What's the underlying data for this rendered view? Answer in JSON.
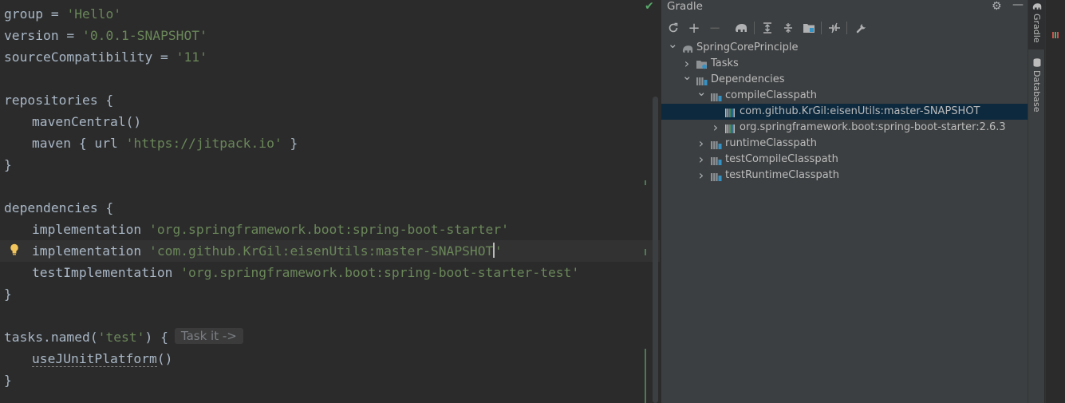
{
  "editor": {
    "lines": [
      {
        "parts": [
          {
            "t": "group",
            "c": "kw"
          },
          {
            "t": " = ",
            "c": "kw"
          },
          {
            "t": "'Hello'",
            "c": "str"
          }
        ]
      },
      {
        "parts": [
          {
            "t": "version",
            "c": "kw"
          },
          {
            "t": " = ",
            "c": "kw"
          },
          {
            "t": "'0.0.1-SNAPSHOT'",
            "c": "str"
          }
        ]
      },
      {
        "parts": [
          {
            "t": "sourceCompatibility",
            "c": "kw"
          },
          {
            "t": " = ",
            "c": "kw"
          },
          {
            "t": "'11'",
            "c": "str"
          }
        ]
      },
      {
        "parts": []
      },
      {
        "parts": [
          {
            "t": "repositories {",
            "c": "kw"
          }
        ]
      },
      {
        "parts": [
          {
            "t": "mavenCentral()",
            "c": "meth"
          }
        ],
        "indent": true
      },
      {
        "parts": [
          {
            "t": "maven { url ",
            "c": "meth"
          },
          {
            "t": "'https://jitpack.io'",
            "c": "str"
          },
          {
            "t": " }",
            "c": "kw"
          }
        ],
        "indent": true
      },
      {
        "parts": [
          {
            "t": "}",
            "c": "kw"
          }
        ]
      },
      {
        "parts": []
      },
      {
        "parts": [
          {
            "t": "dependencies {",
            "c": "kw"
          }
        ]
      },
      {
        "parts": [
          {
            "t": "implementation ",
            "c": "meth"
          },
          {
            "t": "'org.springframework.boot:spring-boot-starter'",
            "c": "str"
          }
        ],
        "indent": true
      },
      {
        "parts": [
          {
            "t": "implementation ",
            "c": "meth"
          },
          {
            "t": "'com.github.KrGil:eisenUtils:master-SNAPSHOT",
            "c": "str"
          },
          {
            "caret": true
          },
          {
            "t": "'",
            "c": "str"
          }
        ],
        "indent": true,
        "current": true
      },
      {
        "parts": [
          {
            "t": "testImplementation ",
            "c": "meth"
          },
          {
            "t": "'org.springframework.boot:spring-boot-starter-test'",
            "c": "str"
          }
        ],
        "indent": true
      },
      {
        "parts": [
          {
            "t": "}",
            "c": "kw"
          }
        ]
      },
      {
        "parts": []
      },
      {
        "parts": [
          {
            "t": "tasks",
            "c": "kw"
          },
          {
            "t": ".named(",
            "c": "kw"
          },
          {
            "t": "'test'",
            "c": "str"
          },
          {
            "t": ") {",
            "c": "kw"
          },
          {
            "hint": "Task it ->"
          }
        ]
      },
      {
        "parts": [
          {
            "t": "useJUnitPlatform",
            "c": "meth",
            "u": true
          },
          {
            "t": "()",
            "c": "kw"
          }
        ],
        "indent": true
      },
      {
        "parts": [
          {
            "t": "}",
            "c": "kw"
          }
        ]
      }
    ]
  },
  "gradle": {
    "title": "Gradle",
    "header_buttons": [
      "gear-icon",
      "minimize-icon"
    ],
    "toolbar": [
      "refresh-icon",
      "add-icon",
      "remove-icon",
      "elephant-icon",
      "expand-all-icon",
      "collapse-all-icon",
      "folder-icon",
      "toggle-offline-icon",
      "wrench-icon"
    ],
    "tree": [
      {
        "label": "SpringCorePrinciple",
        "level": 0,
        "arrow": "down",
        "icon": "elephant"
      },
      {
        "label": "Tasks",
        "level": 1,
        "arrow": "right",
        "icon": "folder-gear"
      },
      {
        "label": "Dependencies",
        "level": 1,
        "arrow": "down",
        "icon": "library"
      },
      {
        "label": "compileClasspath",
        "level": 2,
        "arrow": "down",
        "icon": "library"
      },
      {
        "label": "com.github.KrGil:eisenUtils:master-SNAPSHOT",
        "level": 3,
        "arrow": "none",
        "icon": "bars",
        "selected": true
      },
      {
        "label": "org.springframework.boot:spring-boot-starter:2.6.3",
        "level": 3,
        "arrow": "right",
        "icon": "bars"
      },
      {
        "label": "runtimeClasspath",
        "level": 2,
        "arrow": "right",
        "icon": "library"
      },
      {
        "label": "testCompileClasspath",
        "level": 2,
        "arrow": "right",
        "icon": "library"
      },
      {
        "label": "testRuntimeClasspath",
        "level": 2,
        "arrow": "right",
        "icon": "library"
      }
    ]
  },
  "right_strip": {
    "tabs": [
      {
        "label": "Gradle",
        "active": true
      },
      {
        "label": "Database",
        "active": false
      }
    ]
  }
}
